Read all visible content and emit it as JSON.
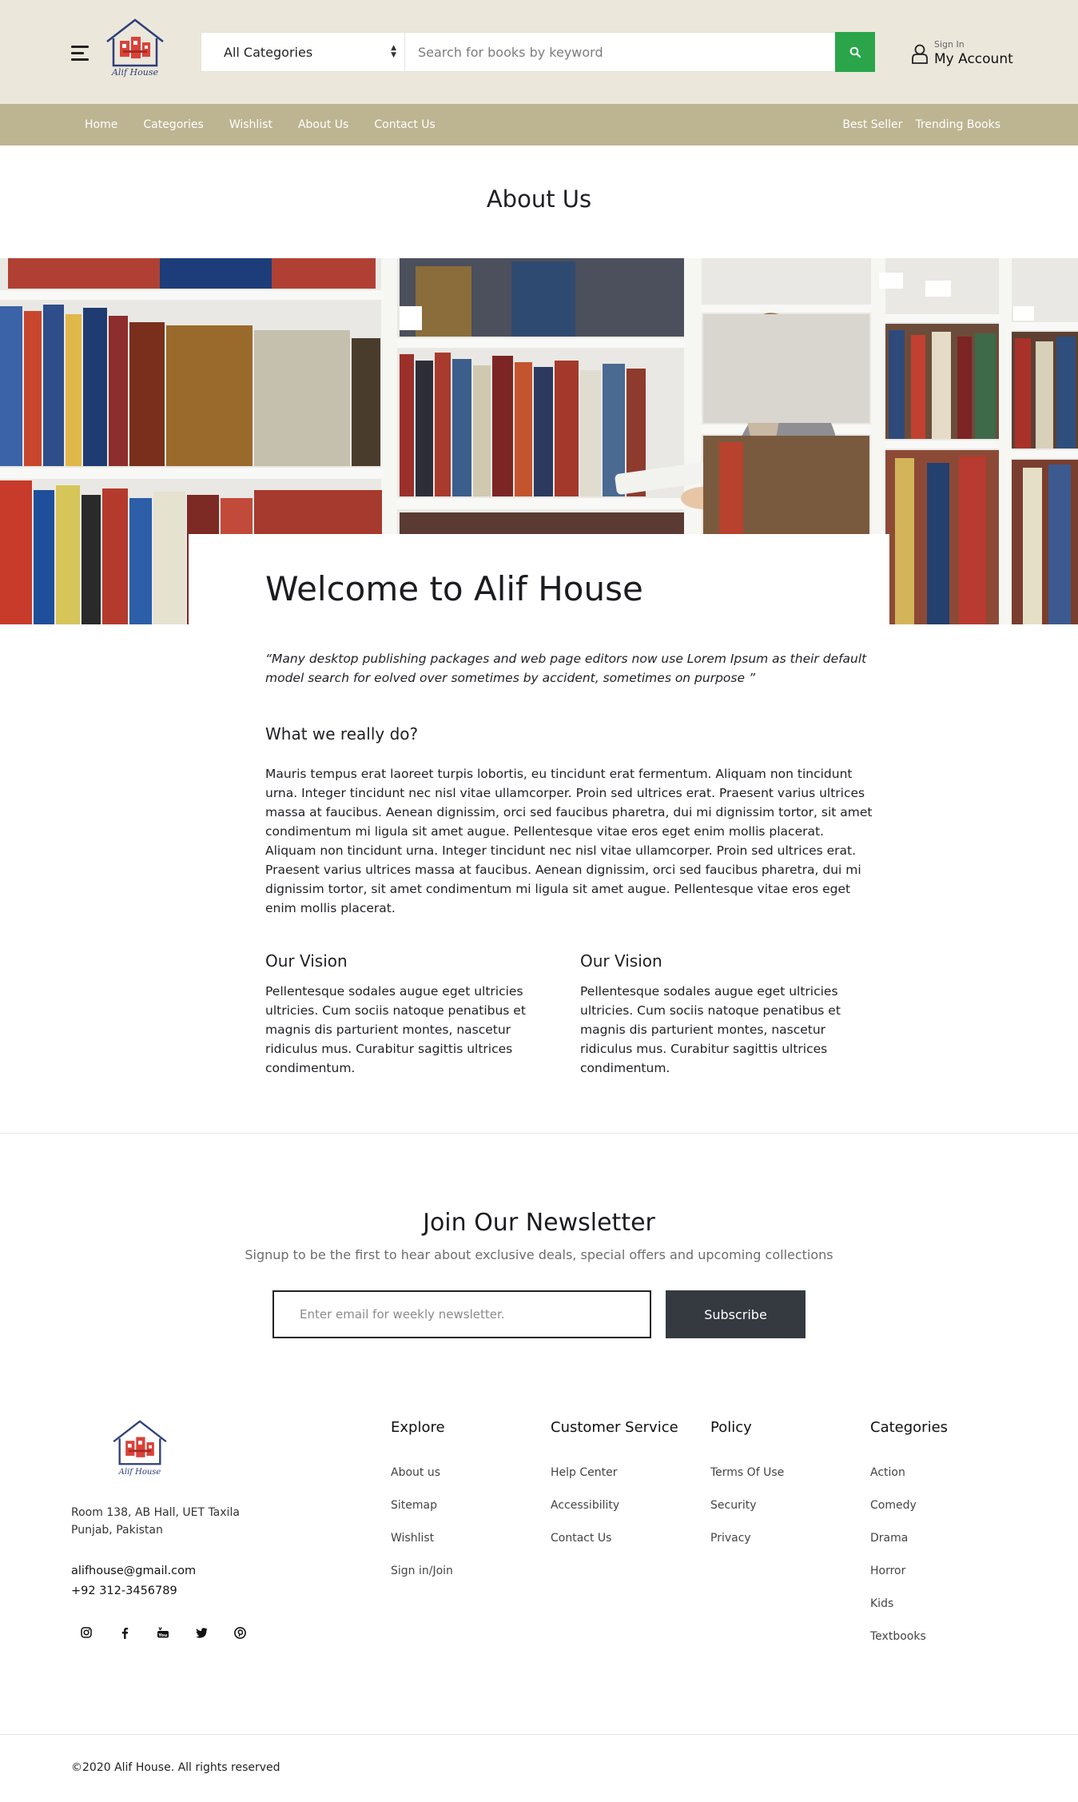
{
  "header": {
    "logo_text": "Alif House",
    "category_select": "All Categories",
    "search_placeholder": "Search for books by keyword",
    "account": {
      "signin_label": "Sign In",
      "account_label": "My Account"
    }
  },
  "nav": {
    "left": [
      "Home",
      "Categories",
      "Wishlist",
      "About Us",
      "Contact Us"
    ],
    "right": [
      "Best Seller",
      "Trending Books"
    ]
  },
  "about": {
    "page_title": "About Us",
    "welcome": "Welcome to Alif House",
    "quote": "“Many desktop publishing packages and web page editors now use Lorem Ipsum as their default model search for eolved over sometimes by accident, sometimes on purpose ”",
    "what_heading": "What we really do?",
    "what_body": "Mauris tempus erat laoreet turpis lobortis, eu tincidunt erat fermentum. Aliquam non tincidunt urna. Integer tincidunt nec nisl vitae ullamcorper. Proin sed ultrices erat. Praesent varius ultrices massa at faucibus. Aenean dignissim, orci sed faucibus pharetra, dui mi dignissim tortor, sit amet condimentum mi ligula sit amet augue. Pellentesque vitae eros eget enim mollis placerat. Aliquam non tincidunt urna. Integer tincidunt nec nisl vitae ullamcorper. Proin sed ultrices erat. Praesent varius ultrices massa at faucibus. Aenean dignissim, orci sed faucibus pharetra, dui mi dignissim tortor, sit amet condimentum mi ligula sit amet augue. Pellentesque vitae eros eget enim mollis placerat.",
    "vision": [
      {
        "heading": "Our Vision",
        "body": "Pellentesque sodales augue eget ultricies ultricies. Cum sociis natoque penatibus et magnis dis parturient montes, nascetur ridiculus mus. Curabitur sagittis ultrices condimentum."
      },
      {
        "heading": "Our Vision",
        "body": "Pellentesque sodales augue eget ultricies ultricies. Cum sociis natoque penatibus et magnis dis parturient montes, nascetur ridiculus mus. Curabitur sagittis ultrices condimentum."
      }
    ]
  },
  "newsletter": {
    "title": "Join Our Newsletter",
    "subtitle": "Signup to be the first to hear about exclusive deals, special offers and upcoming collections",
    "email_placeholder": "Enter email for weekly newsletter.",
    "button": "Subscribe"
  },
  "footer": {
    "logo_text": "Alif House",
    "address": [
      "Room 138, AB Hall, UET Taxila",
      "Punjab, Pakistan"
    ],
    "email": "alifhouse@gmail.com",
    "phone": "+92 312-3456789",
    "socials": [
      "instagram-icon",
      "facebook-icon",
      "youtube-icon",
      "twitter-icon",
      "pinterest-icon"
    ],
    "columns": [
      {
        "title": "Explore",
        "links": [
          "About us",
          "Sitemap",
          "Wishlist",
          "Sign in/Join"
        ]
      },
      {
        "title": "Customer Service",
        "links": [
          "Help Center",
          "Accessibility",
          "Contact Us"
        ]
      },
      {
        "title": "Policy",
        "links": [
          "Terms Of Use",
          "Security",
          "Privacy"
        ]
      },
      {
        "title": "Categories",
        "links": [
          "Action",
          "Comedy",
          "Drama",
          "Horror",
          "Kids",
          "Textbooks"
        ]
      }
    ],
    "copyright": "©2020 Alif House. All rights reserved"
  },
  "colors": {
    "topbar_bg": "#ebe7db",
    "nav_bg": "#bdb491",
    "search_button": "#2aa54a",
    "subscribe_button": "#343a40"
  }
}
